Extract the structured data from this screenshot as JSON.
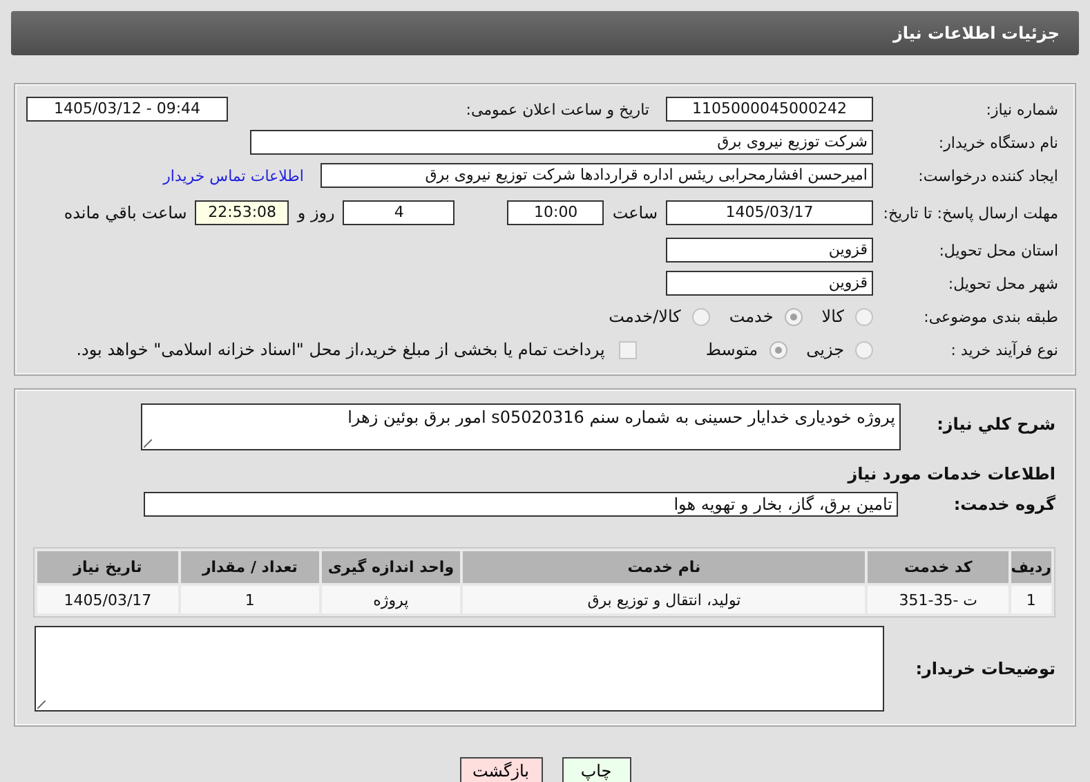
{
  "header": {
    "title": "جزئیات اطلاعات نیاز"
  },
  "need_number": {
    "label": "شماره نیاز:",
    "value": "1105000045000242"
  },
  "announce": {
    "label": "تاریخ و ساعت اعلان عمومی:",
    "value": "1405/03/12 - 09:44"
  },
  "buyer_org": {
    "label": "نام دستگاه خریدار:",
    "value": "شرکت توزیع نیروی برق"
  },
  "requester": {
    "label": "ایجاد کننده درخواست:",
    "value": "امیرحسن افشارمحرابی ریئس اداره قراردادها شرکت توزیع نیروی برق",
    "link": "اطلاعات تماس خریدار"
  },
  "deadline": {
    "label": "مهلت ارسال پاسخ: تا تاریخ:",
    "date": "1405/03/17",
    "time_label": "ساعت",
    "time": "10:00",
    "days": "4",
    "days_label": "روز و",
    "remaining": "22:53:08",
    "remaining_label": "ساعت باقي مانده"
  },
  "province": {
    "label": "استان محل تحویل:",
    "value": "قزوین"
  },
  "city": {
    "label": "شهر محل تحویل:",
    "value": "قزوین"
  },
  "category": {
    "label": "طبقه بندی موضوعی:",
    "options": [
      {
        "label": "کالا",
        "selected": false
      },
      {
        "label": "خدمت",
        "selected": true
      },
      {
        "label": "کالا/خدمت",
        "selected": false
      }
    ]
  },
  "process": {
    "label": "نوع فرآیند خرید :",
    "options": [
      {
        "label": "جزیی",
        "selected": false
      },
      {
        "label": "متوسط",
        "selected": true
      }
    ],
    "treasury": {
      "label": "پرداخت تمام یا بخشی از مبلغ خرید،از محل \"اسناد خزانه اسلامی\" خواهد بود.",
      "checked": false
    }
  },
  "description": {
    "label": "شرح کلي نياز:",
    "value": "پروژه خودیاری خدایار حسینی به شماره سنم s05020316 امور برق بوئین زهرا"
  },
  "services_heading": "اطلاعات خدمات مورد نیاز",
  "service_group": {
    "label": "گروه خدمت:",
    "value": "تامین برق، گاز، بخار و تهویه هوا"
  },
  "table": {
    "columns": [
      "ردیف",
      "کد خدمت",
      "نام خدمت",
      "واحد اندازه گیری",
      "تعداد / مقدار",
      "تاریخ نیاز"
    ],
    "rows": [
      [
        "1",
        "ت -35-351",
        "تولید، انتقال و توزیع برق",
        "پروژه",
        "1",
        "1405/03/17"
      ]
    ]
  },
  "buyer_notes": {
    "label": "توضیحات خریدار:"
  },
  "buttons": [
    {
      "label": "چاپ",
      "kind": "print"
    },
    {
      "label": "بازگشت",
      "kind": "back"
    }
  ]
}
